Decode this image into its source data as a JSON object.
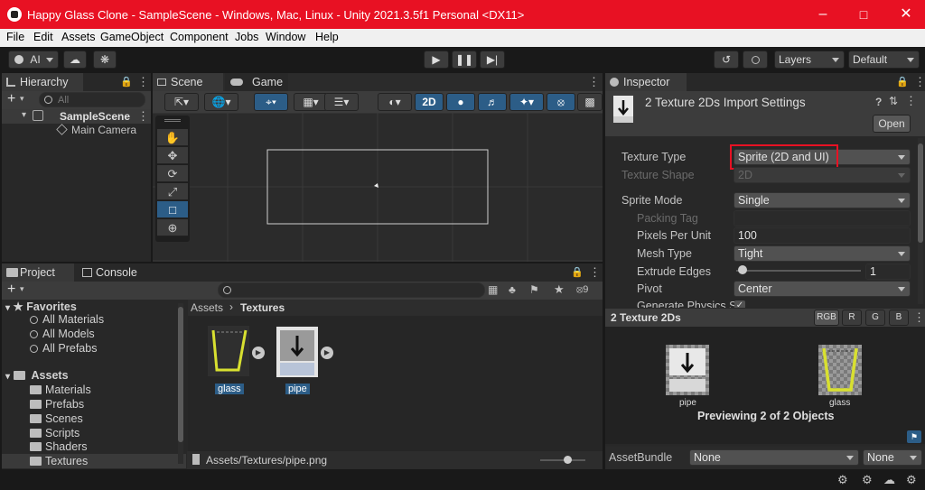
{
  "window": {
    "title": "Happy Glass Clone - SampleScene - Windows, Mac, Linux - Unity 2021.3.5f1 Personal <DX11>"
  },
  "menu": [
    "File",
    "Edit",
    "Assets",
    "GameObject",
    "Component",
    "Jobs",
    "Window",
    "Help"
  ],
  "toolbar": {
    "account": "AI",
    "layers": "Layers",
    "layout": "Default"
  },
  "hierarchy": {
    "tab": "Hierarchy",
    "search_placeholder": "All",
    "scene": "SampleScene",
    "items": [
      "Main Camera"
    ]
  },
  "scene": {
    "tab_scene": "Scene",
    "tab_game": "Game",
    "mode_2d": "2D"
  },
  "project": {
    "tab_project": "Project",
    "tab_console": "Console",
    "favorites_label": "Favorites",
    "favorites": [
      "All Materials",
      "All Models",
      "All Prefabs"
    ],
    "assets_label": "Assets",
    "folders": [
      "Materials",
      "Prefabs",
      "Scenes",
      "Scripts",
      "Shaders",
      "Textures"
    ],
    "breadcrumb_root": "Assets",
    "breadcrumb_current": "Textures",
    "assets": [
      "glass",
      "pipe"
    ],
    "footer_path": "Assets/Textures/pipe.png",
    "hidden_count": "9"
  },
  "inspector": {
    "tab": "Inspector",
    "header": "2 Texture 2Ds Import Settings",
    "open_button": "Open",
    "props": {
      "texture_type_label": "Texture Type",
      "texture_type": "Sprite (2D and UI)",
      "texture_shape_label": "Texture Shape",
      "texture_shape": "2D",
      "sprite_mode_label": "Sprite Mode",
      "sprite_mode": "Single",
      "packing_tag_label": "Packing Tag",
      "ppu_label": "Pixels Per Unit",
      "ppu": "100",
      "mesh_type_label": "Mesh Type",
      "mesh_type": "Tight",
      "extrude_label": "Extrude Edges",
      "extrude": "1",
      "pivot_label": "Pivot",
      "pivot": "Center",
      "gen_physics_label": "Generate Physics S"
    },
    "preview": {
      "title": "2 Texture 2Ds",
      "channels": [
        "RGB",
        "R",
        "G",
        "B"
      ],
      "items": [
        "pipe",
        "glass"
      ],
      "caption": "Previewing 2 of 2 Objects"
    },
    "assetbundle": {
      "label": "AssetBundle",
      "value": "None",
      "variant": "None"
    }
  },
  "colors": {
    "titlebar": "#e81123",
    "highlight_box": "#e81123",
    "glass_outline": "#d8e030"
  }
}
